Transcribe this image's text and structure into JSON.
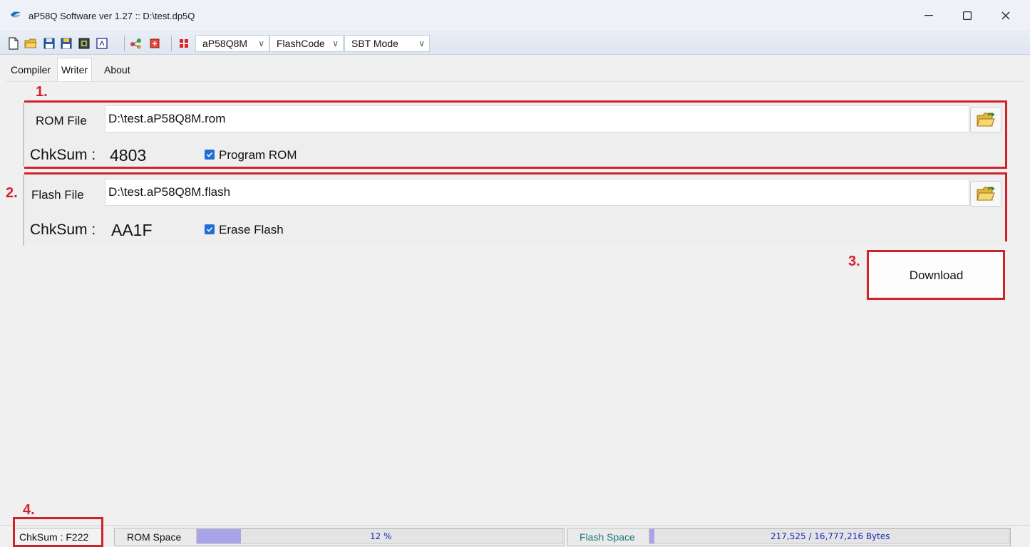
{
  "window": {
    "title": "aP58Q Software ver 1.27 :: D:\\test.dp5Q",
    "minimize": "—",
    "maximize": "☐",
    "close": "✕"
  },
  "toolbar": {
    "icons": [
      "new-file-icon",
      "open-folder-icon",
      "save-icon",
      "save-as-icon",
      "compile-icon",
      "calendar-icon",
      "connect-icon",
      "export-icon",
      "chip-icon"
    ],
    "chip_select": "aP58Q8M",
    "code_select": "FlashCode",
    "mode_select": "SBT Mode"
  },
  "tabs": [
    {
      "label": "Compiler",
      "active": false
    },
    {
      "label": "Writer",
      "active": true
    },
    {
      "label": "About",
      "active": false
    }
  ],
  "annotations": {
    "step1": "1.",
    "step2": "2.",
    "step3": "3.",
    "step4": "4."
  },
  "rom": {
    "label": "ROM File",
    "path": "D:\\test.aP58Q8M.rom",
    "chksum_label": "ChkSum :",
    "chksum_value": "4803",
    "option_label": "Program ROM",
    "option_checked": true
  },
  "flash": {
    "label": "Flash File",
    "path": "D:\\test.aP58Q8M.flash",
    "chksum_label": "ChkSum :",
    "chksum_value": "AA1F",
    "option_label": "Erase Flash",
    "option_checked": true
  },
  "download_label": "Download",
  "statusbar": {
    "chksum": "ChkSum : F222",
    "rom_space_label": "ROM Space",
    "rom_space_percent": 12,
    "rom_space_text": "12 %",
    "flash_space_label": "Flash Space",
    "flash_space_fraction": 0.013,
    "flash_space_text": "217,525 / 16,777,216  Bytes"
  },
  "colors": {
    "annotation_red": "#d0222b",
    "checkbox_blue": "#1d6fd6",
    "progress_fill": "#a9a3ea",
    "progress_text": "#1a2ab8",
    "flash_label_teal": "#1f7a7a"
  }
}
